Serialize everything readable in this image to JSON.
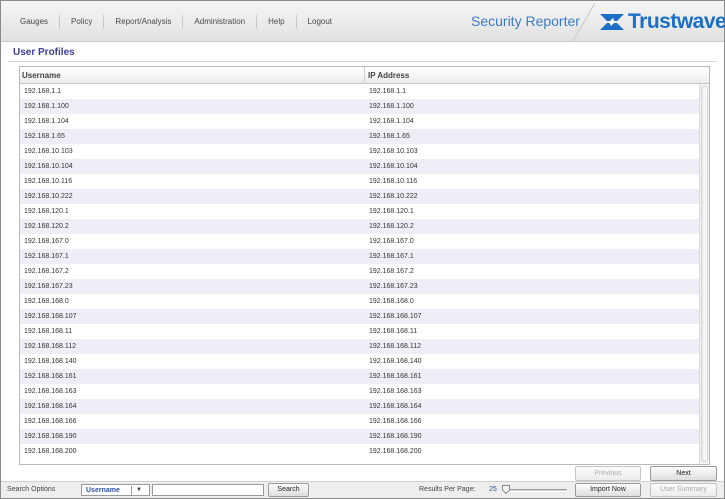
{
  "nav": {
    "items": [
      "Gauges",
      "Policy",
      "Report/Analysis",
      "Administration",
      "Help",
      "Logout"
    ],
    "product": "Security Reporter",
    "logo_text": "Trustwave",
    "logo_superscript": "®",
    "brand_color": "#1c6ec7"
  },
  "page": {
    "title": "User Profiles"
  },
  "table": {
    "columns": {
      "username": "Username",
      "ip_address": "IP Address"
    },
    "rows": [
      [
        "192.168.1.1",
        "192.168.1.1"
      ],
      [
        "192.168.1.100",
        "192.168.1.100"
      ],
      [
        "192.168.1.104",
        "192.168.1.104"
      ],
      [
        "192.168.1.65",
        "192.168.1.65"
      ],
      [
        "192.168.10.103",
        "192.168.10.103"
      ],
      [
        "192.168.10.104",
        "192.168.10.104"
      ],
      [
        "192.168.10.116",
        "192.168.10.116"
      ],
      [
        "192.168.10.222",
        "192.168.10.222"
      ],
      [
        "192.168.120.1",
        "192.168.120.1"
      ],
      [
        "192.168.120.2",
        "192.168.120.2"
      ],
      [
        "192.168.167.0",
        "192.168.167.0"
      ],
      [
        "192.168.167.1",
        "192.168.167.1"
      ],
      [
        "192.168.167.2",
        "192.168.167.2"
      ],
      [
        "192.168.167.23",
        "192.168.167.23"
      ],
      [
        "192.168.168.0",
        "192.168.168.0"
      ],
      [
        "192.168.168.107",
        "192.168.168.107"
      ],
      [
        "192.168.168.11",
        "192.168.168.11"
      ],
      [
        "192.168.168.112",
        "192.168.168.112"
      ],
      [
        "192.168.168.140",
        "192.168.168.140"
      ],
      [
        "192.168.168.161",
        "192.168.168.161"
      ],
      [
        "192.168.168.163",
        "192.168.168.163"
      ],
      [
        "192.168.168.164",
        "192.168.168.164"
      ],
      [
        "192.168.168.166",
        "192.168.168.166"
      ],
      [
        "192.168.168.190",
        "192.168.168.190"
      ],
      [
        "192.168.168.200",
        "192.168.168.200"
      ]
    ]
  },
  "pager": {
    "previous": "Previous",
    "next": "Next"
  },
  "footer": {
    "search_options_label": "Search Options",
    "search_field_selected": "Username",
    "search_input_value": "",
    "search_button": "Search",
    "results_per_page_label": "Results Per Page:",
    "results_per_page_value": "25",
    "import_button": "Import Now",
    "user_summary_button": "User Summary"
  },
  "icons": {
    "logo": "trustwave-logo-icon",
    "dropdown": "chevron-down-icon",
    "slider": "slider-thumb-icon"
  }
}
